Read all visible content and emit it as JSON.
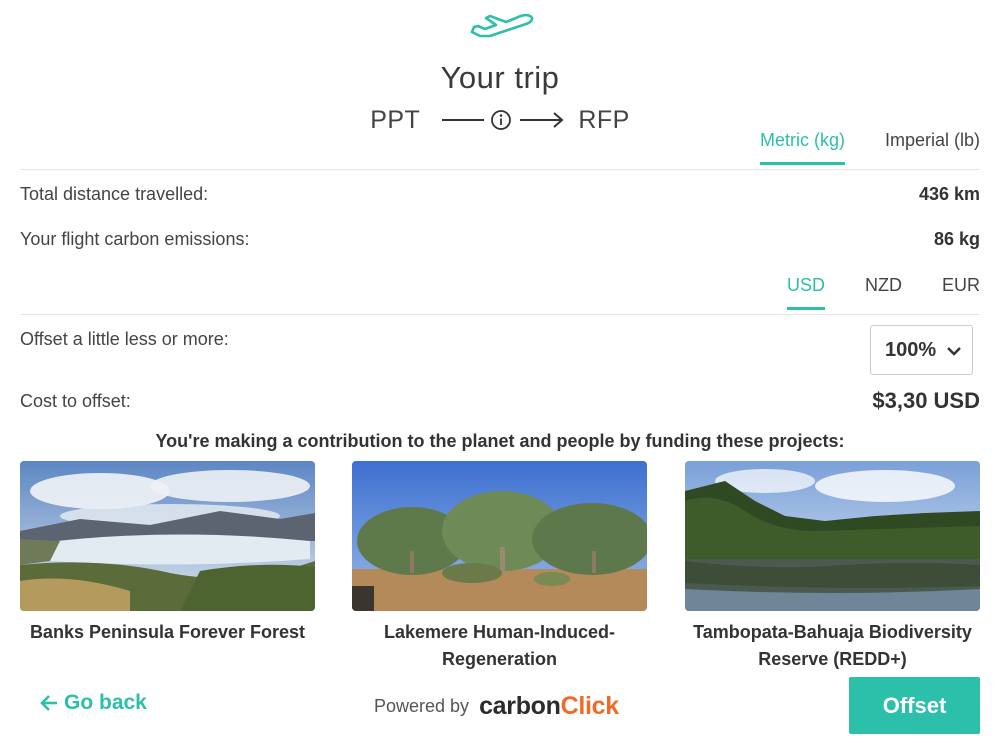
{
  "header": {
    "plane_icon": "airplane-takeoff-icon",
    "title": "Your trip",
    "origin": "PPT",
    "destination": "RFP",
    "info_icon": "info-circle-icon"
  },
  "units_tabs": [
    {
      "label": "Metric (kg)",
      "active": true
    },
    {
      "label": "Imperial (lb)",
      "active": false
    }
  ],
  "stats": {
    "distance_label": "Total distance travelled:",
    "distance_value": "436 km",
    "emissions_label": "Your flight carbon emissions:",
    "emissions_value": "86 kg"
  },
  "currency_tabs": [
    {
      "label": "USD",
      "active": true
    },
    {
      "label": "NZD",
      "active": false
    },
    {
      "label": "EUR",
      "active": false
    }
  ],
  "offset": {
    "label": "Offset a little less or more:",
    "selected": "100%",
    "cost_label": "Cost to offset:",
    "cost_value": "$3,30 USD"
  },
  "contribution_text": "You're making a contribution to the planet and people by funding these projects:",
  "projects": [
    {
      "name": "Banks Peninsula Forever Forest"
    },
    {
      "name": "Lakemere Human-Induced-Regeneration"
    },
    {
      "name": "Tambopata-Bahuaja Biodiversity Reserve (REDD+)"
    }
  ],
  "footer": {
    "go_back": "Go back",
    "powered_by": "Powered by",
    "logo_part1": "carbon",
    "logo_part2": "Click",
    "offset_button": "Offset"
  },
  "colors": {
    "accent": "#2cbfa9",
    "logo_orange": "#f06b2a",
    "text": "#333333"
  }
}
